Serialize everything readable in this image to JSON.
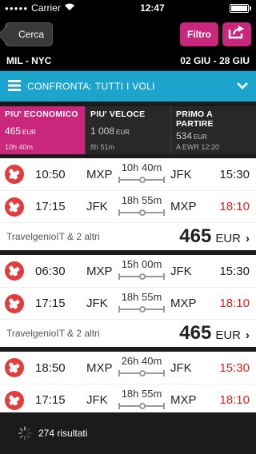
{
  "status": {
    "carrier": "Carrier",
    "time": "12:47"
  },
  "nav": {
    "back_label": "Cerca",
    "filter_label": "Filtro"
  },
  "route": {
    "cities": "MIL - NYC",
    "dates": "02 GIU - 28 GIU"
  },
  "compare": {
    "label": "CONFRONTA: TUTTI I VOLI"
  },
  "tabs": [
    {
      "title": "PIU' ECONOMICO",
      "price": "465",
      "currency": "EUR",
      "sub": "10h 40m"
    },
    {
      "title": "PIU' VELOCE",
      "price": "1 008",
      "currency": "EUR",
      "sub": "8h 51m"
    },
    {
      "title": "PRIMO A PARTIRE",
      "price": "534",
      "currency": "EUR",
      "sub": "A EWR 12:20"
    }
  ],
  "results": [
    {
      "legs": [
        {
          "dep_time": "10:50",
          "dep_apt": "MXP",
          "duration": "10h 40m",
          "arr_apt": "JFK",
          "arr_time": "15:30",
          "arr_red": false
        },
        {
          "dep_time": "17:15",
          "dep_apt": "JFK",
          "duration": "18h 55m",
          "arr_apt": "MXP",
          "arr_time": "18:10",
          "arr_red": true
        }
      ],
      "agencies": "TravelgenioIT & 2 altri",
      "price": "465",
      "currency": "EUR"
    },
    {
      "legs": [
        {
          "dep_time": "06:30",
          "dep_apt": "MXP",
          "duration": "15h 00m",
          "arr_apt": "JFK",
          "arr_time": "15:30",
          "arr_red": false
        },
        {
          "dep_time": "17:15",
          "dep_apt": "JFK",
          "duration": "18h 55m",
          "arr_apt": "MXP",
          "arr_time": "18:10",
          "arr_red": true
        }
      ],
      "agencies": "TravelgenioIT & 2 altri",
      "price": "465",
      "currency": "EUR"
    },
    {
      "legs": [
        {
          "dep_time": "18:50",
          "dep_apt": "MXP",
          "duration": "26h 40m",
          "arr_apt": "JFK",
          "arr_time": "15:30",
          "arr_red": true
        },
        {
          "dep_time": "17:15",
          "dep_apt": "JFK",
          "duration": "18h 55m",
          "arr_apt": "MXP",
          "arr_time": "18:10",
          "arr_red": true
        }
      ],
      "agencies": "",
      "price": "",
      "currency": ""
    }
  ],
  "footer": {
    "count_label": "274 risultati"
  },
  "colors": {
    "accent": "#c8277c",
    "compare": "#1ba4cc",
    "arrival_red": "#e41e1e"
  }
}
